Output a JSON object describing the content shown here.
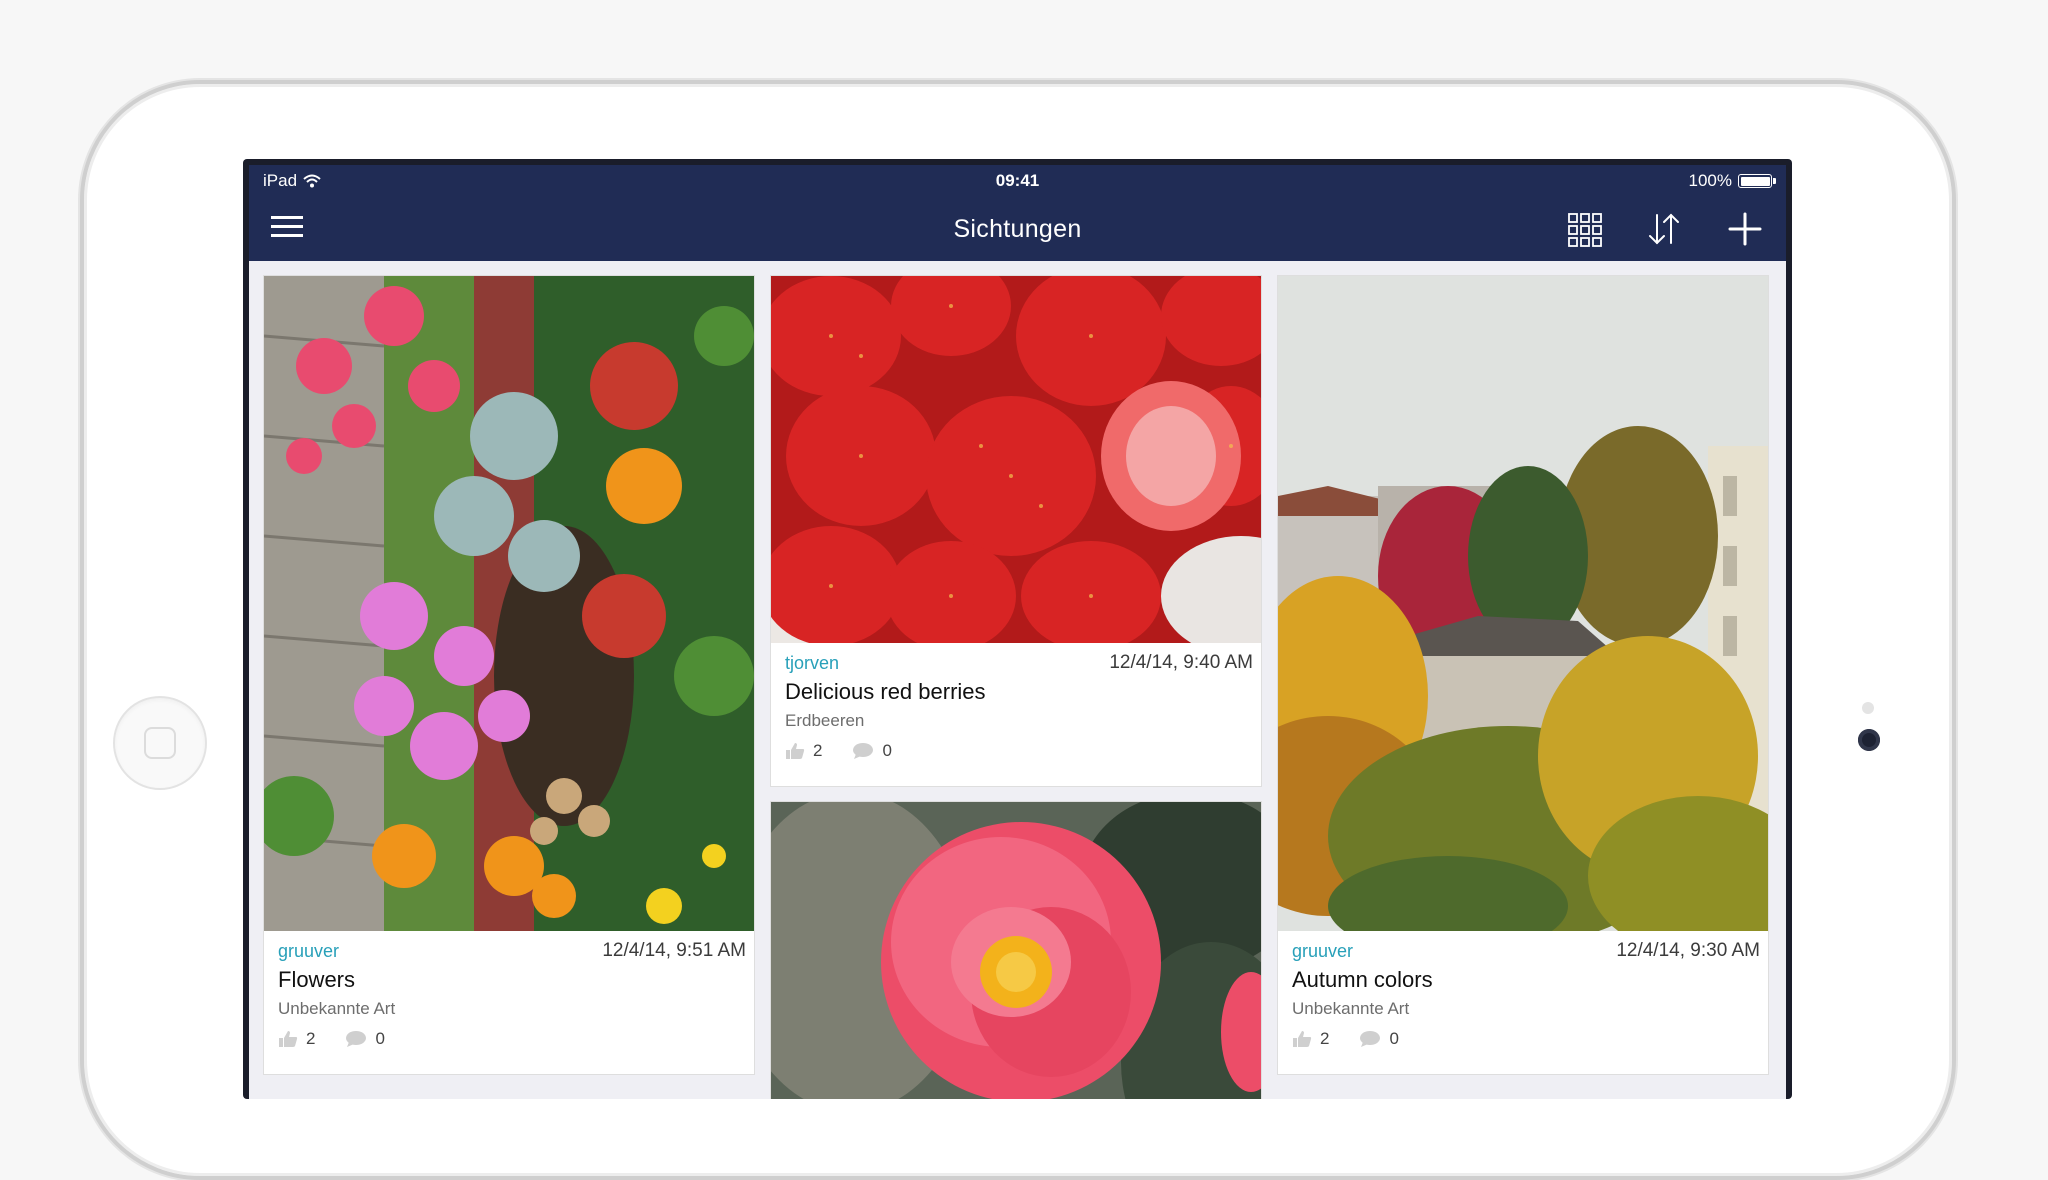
{
  "statusbar": {
    "carrier": "iPad",
    "time": "09:41",
    "battery": "100%"
  },
  "navbar": {
    "title": "Sichtungen",
    "icons": [
      "menu-icon",
      "grid-view-icon",
      "sort-icon",
      "add-icon"
    ]
  },
  "cards": [
    {
      "user": "gruuver",
      "date": "12/4/14, 9:51 AM",
      "title": "Flowers",
      "species": "Unbekannte Art",
      "likes": "2",
      "comments": "0"
    },
    {
      "user": "tjorven",
      "date": "12/4/14, 9:40 AM",
      "title": "Delicious red berries",
      "species": "Erdbeeren",
      "likes": "2",
      "comments": "0"
    },
    {
      "user": "gruuver",
      "date": "12/4/14, 9:30 AM",
      "title": "Autumn colors",
      "species": "Unbekannte Art",
      "likes": "2",
      "comments": "0"
    }
  ],
  "colors": {
    "navbar": "#202c55",
    "username": "#28a0b9",
    "background": "#efeff4"
  }
}
